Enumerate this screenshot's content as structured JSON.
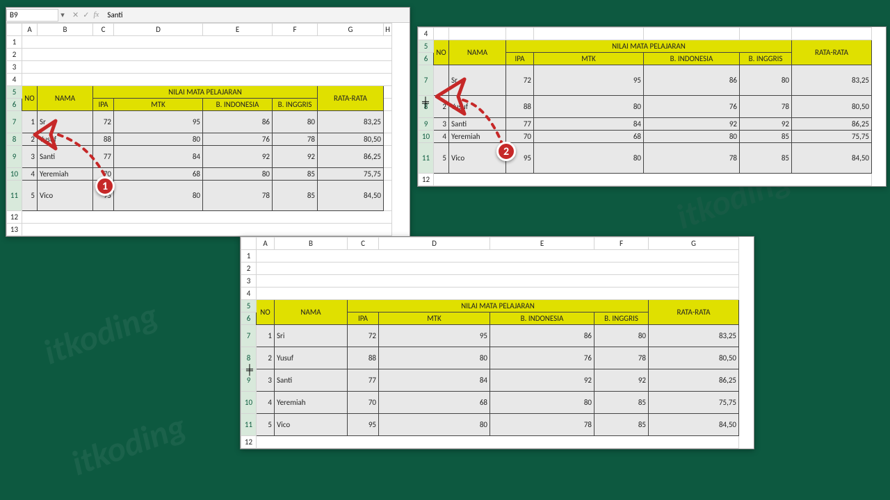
{
  "formula_bar": {
    "cell_ref": "B9",
    "value": "Santi"
  },
  "badges": {
    "one": "1",
    "two": "2"
  },
  "watermark": "itkoding",
  "headers": {
    "no": "NO",
    "nama": "NAMA",
    "group": "NILAI MATA PELAJARAN",
    "ipa": "IPA",
    "mtk": "MTK",
    "bindo": "B. INDONESIA",
    "bing": "B. INGGRIS",
    "rata": "RATA-RATA"
  },
  "cols": {
    "panel1": [
      "A",
      "B",
      "C",
      "D",
      "E",
      "F",
      "G"
    ],
    "panel3": [
      "A",
      "B",
      "C",
      "D",
      "E",
      "F",
      "G"
    ]
  },
  "rows_p2": [
    "4",
    "5",
    "6",
    "7",
    "8",
    "9",
    "10",
    "11",
    "12"
  ],
  "chart_data": {
    "type": "table",
    "columns": [
      "NO",
      "NAMA",
      "IPA",
      "MTK",
      "B. INDONESIA",
      "B. INGGRIS",
      "RATA-RATA"
    ],
    "rows": [
      {
        "no": "1",
        "nama": "Sri",
        "ipa": "72",
        "mtk": "95",
        "bindo": "86",
        "bing": "80",
        "rata": "83,25"
      },
      {
        "no": "2",
        "nama": "Yusuf",
        "ipa": "88",
        "mtk": "80",
        "bindo": "76",
        "bing": "78",
        "rata": "80,50"
      },
      {
        "no": "3",
        "nama": "Santi",
        "ipa": "77",
        "mtk": "84",
        "bindo": "92",
        "bing": "92",
        "rata": "86,25"
      },
      {
        "no": "4",
        "nama": "Yeremiah",
        "ipa": "70",
        "mtk": "68",
        "bindo": "80",
        "bing": "85",
        "rata": "75,75"
      },
      {
        "no": "5",
        "nama": "Vico",
        "ipa": "95",
        "mtk": "80",
        "bindo": "78",
        "bing": "85",
        "rata": "84,50"
      }
    ]
  }
}
